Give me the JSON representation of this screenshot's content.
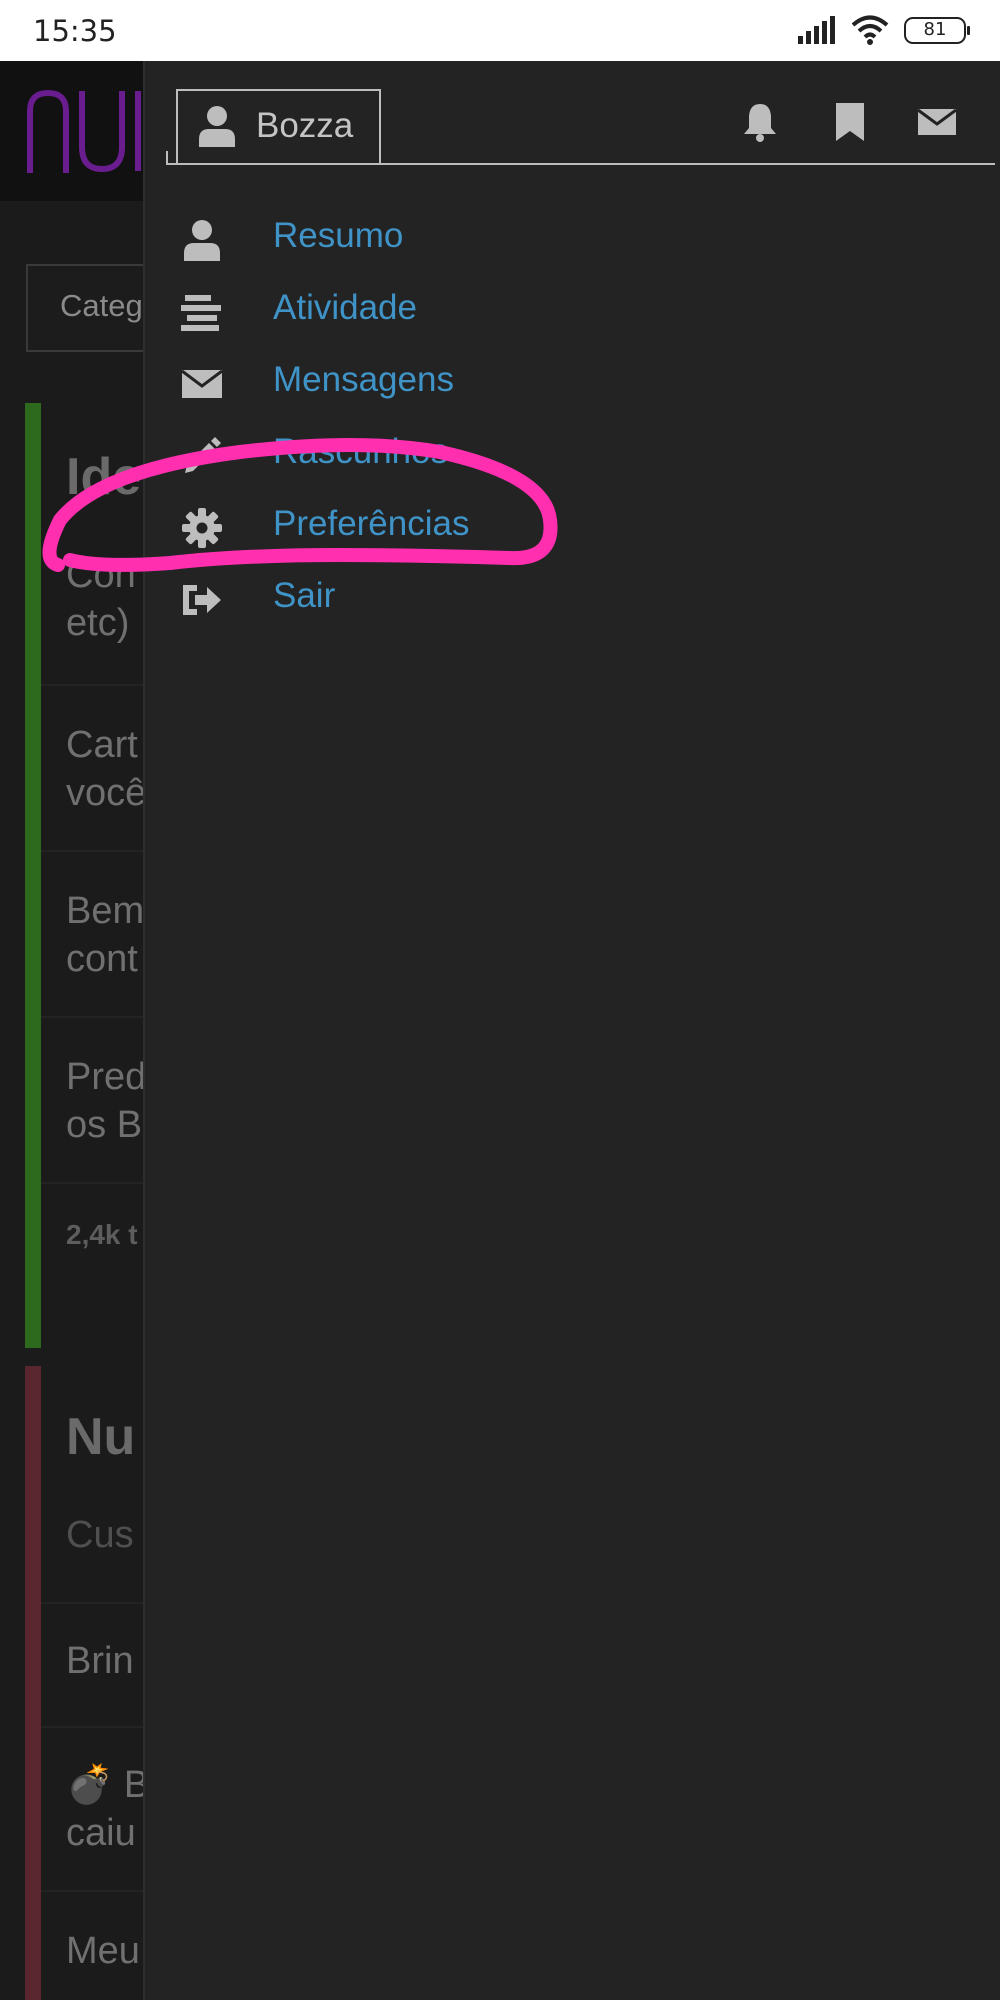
{
  "status_bar": {
    "time": "15:35",
    "battery_level": "81",
    "icons": [
      "signal-icon",
      "wifi-icon",
      "battery-icon"
    ]
  },
  "background_page": {
    "category_select_text": "Categ",
    "green_category": {
      "title": "Ide",
      "lines": [
        "Con\netc)",
        "Cart\nvocê",
        "Bem\ncont",
        "Pred\nos B"
      ],
      "footer": "2,4k t"
    },
    "red_category": {
      "title": "Nu",
      "subtitle": "Cus",
      "lines": [
        "Brin",
        "💣 B\ncaiu",
        "Meu"
      ]
    }
  },
  "drawer": {
    "profile_tab_label": "Bozza",
    "top_icons": [
      "bell-icon",
      "bookmark-icon",
      "envelope-icon"
    ],
    "menu_items": [
      {
        "label": "Resumo",
        "icon": "user-icon"
      },
      {
        "label": "Atividade",
        "icon": "list-icon"
      },
      {
        "label": "Mensagens",
        "icon": "envelope-icon"
      },
      {
        "label": "Rascunhos",
        "icon": "pencil-icon"
      },
      {
        "label": "Preferências",
        "icon": "gear-icon"
      },
      {
        "label": "Sair",
        "icon": "sign-out-icon"
      }
    ]
  },
  "colors": {
    "menu_link": "#3f93c7",
    "highlight_stroke": "#ff2fb0",
    "drawer_bg": "#232323"
  }
}
